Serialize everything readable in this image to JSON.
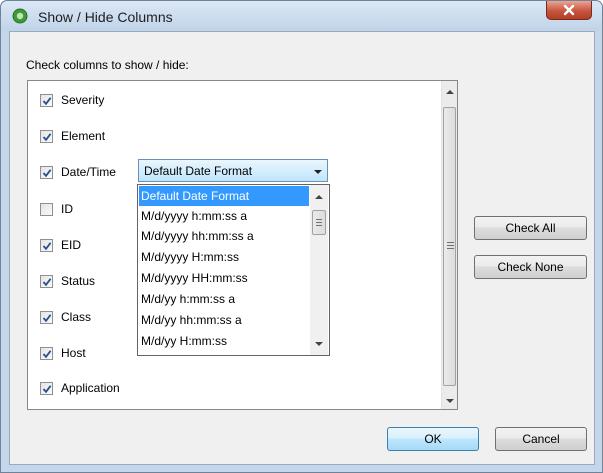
{
  "window": {
    "title": "Show / Hide Columns",
    "close_label": "X"
  },
  "heading": "Check columns to show / hide:",
  "columns": [
    {
      "label": "Severity",
      "checked": true
    },
    {
      "label": "Element",
      "checked": true
    },
    {
      "label": "Date/Time",
      "checked": true
    },
    {
      "label": "ID",
      "checked": false
    },
    {
      "label": "EID",
      "checked": true
    },
    {
      "label": "Status",
      "checked": true
    },
    {
      "label": "Class",
      "checked": true
    },
    {
      "label": "Host",
      "checked": true
    },
    {
      "label": "Application",
      "checked": true
    }
  ],
  "date_format": {
    "selected": "Default Date Format",
    "options": [
      "Default Date Format",
      "M/d/yyyy h:mm:ss a",
      "M/d/yyyy hh:mm:ss a",
      "M/d/yyyy H:mm:ss",
      "M/d/yyyy HH:mm:ss",
      "M/d/yy h:mm:ss a",
      "M/d/yy hh:mm:ss a",
      "M/d/yy H:mm:ss"
    ]
  },
  "buttons": {
    "check_all": "Check All",
    "check_none": "Check None",
    "ok": "OK",
    "cancel": "Cancel"
  },
  "colors": {
    "selection": "#3399ff",
    "check": "#2a4f8f"
  }
}
